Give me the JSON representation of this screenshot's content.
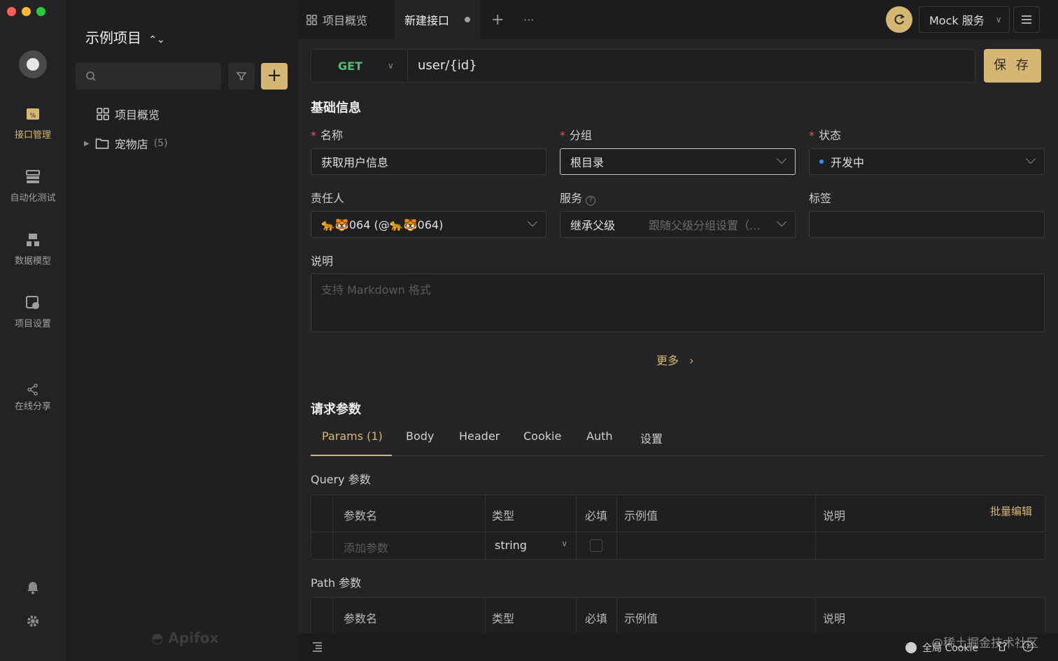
{
  "window": {
    "traffic_colors": [
      "#ff5f57",
      "#febc2e",
      "#28c840"
    ]
  },
  "nav": {
    "items": [
      {
        "label": "接口管理",
        "icon": "api-icon",
        "active": true
      },
      {
        "label": "自动化测试",
        "icon": "automation-icon"
      },
      {
        "label": "数据模型",
        "icon": "data-model-icon"
      },
      {
        "label": "项目设置",
        "icon": "project-settings-icon"
      },
      {
        "label": "在线分享",
        "icon": "share-icon"
      }
    ],
    "bottom_icons": [
      "bell-icon",
      "gear-icon"
    ]
  },
  "tree": {
    "project_title": "示例项目",
    "items": [
      {
        "label": "项目概览",
        "icon": "grid-icon"
      },
      {
        "label": "宠物店",
        "icon": "folder-icon",
        "count": "(5)"
      }
    ],
    "brand": "Apifox"
  },
  "tabs": [
    {
      "label": "项目概览",
      "icon": "grid-icon"
    },
    {
      "label": "新建接口",
      "active": true,
      "unsaved": true
    }
  ],
  "topbar": {
    "mock_label": "Mock 服务",
    "add": "+",
    "more": "···"
  },
  "request": {
    "method": "GET",
    "url": "user/{id}",
    "save_label": "保 存"
  },
  "basic": {
    "section_title": "基础信息",
    "name_label": "名称",
    "name_value": "获取用户信息",
    "group_label": "分组",
    "group_value": "根目录",
    "status_label": "状态",
    "status_value": "开发中",
    "status_color": "#3a8ee6",
    "owner_label": "责任人",
    "owner_value": "🐆🐯064 (@🐆🐯064)",
    "service_label": "服务",
    "service_value": "继承父级",
    "service_hint": "跟随父级分组设置（...",
    "tags_label": "标签",
    "desc_label": "说明",
    "desc_placeholder": "支持 Markdown 格式",
    "more_label": "更多"
  },
  "params": {
    "section_title": "请求参数",
    "tabs": [
      "Params (1)",
      "Body",
      "Header",
      "Cookie",
      "Auth",
      "设置"
    ],
    "query_title": "Query 参数",
    "path_title": "Path 参数",
    "columns": [
      "参数名",
      "类型",
      "必填",
      "示例值",
      "说明"
    ],
    "batch_edit": "批量编辑",
    "add_placeholder": "添加参数",
    "type_value": "string"
  },
  "statusbar": {
    "cookie_label": "全局 Cookie",
    "watermark": "@稀土掘金技术社区"
  }
}
